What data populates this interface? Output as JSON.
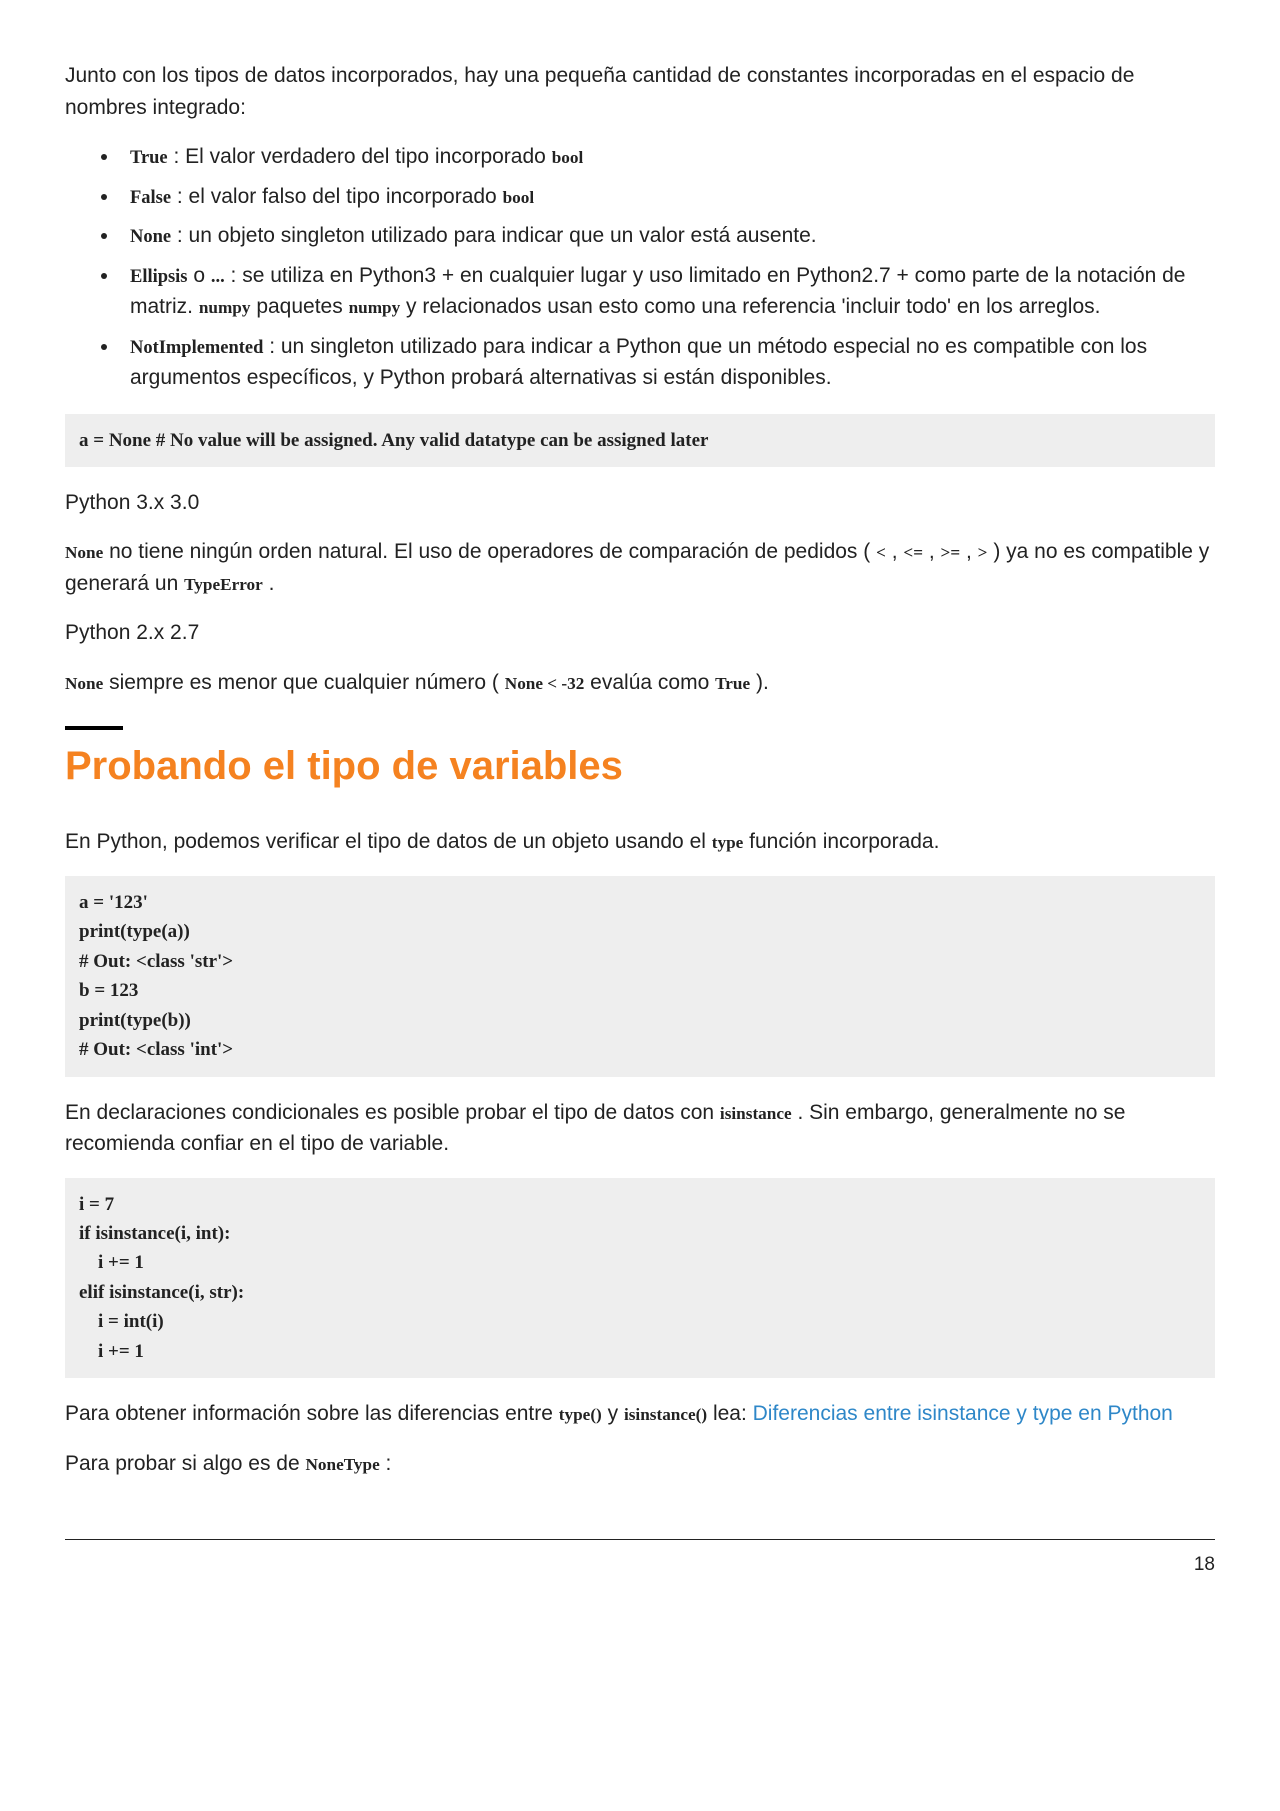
{
  "intro": "Junto con los tipos de datos incorporados, hay una pequeña cantidad de constantes incorporadas en el espacio de nombres integrado:",
  "bullets": {
    "b1_code": "True",
    "b1_text": " : El valor verdadero del tipo incorporado",
    "b1_code2": "bool",
    "b2_code": "False",
    "b2_text": " : el valor falso del tipo incorporado",
    "b2_code2": "bool",
    "b3_code": "None",
    "b3_text": " : un objeto singleton utilizado para indicar que un valor está ausente.",
    "b4_code": "Ellipsis",
    "b4_text_a": " o ",
    "b4_code2": "...",
    "b4_text_b": " : se utiliza en Python3 + en cualquier lugar y uso limitado en Python2.7 + como parte de la notación de matriz. ",
    "b4_code3": "numpy",
    "b4_text_c": " paquetes ",
    "b4_code4": "numpy",
    "b4_text_d": " y relacionados usan esto como una referencia 'incluir todo' en los arreglos.",
    "b5_code": "NotImplemented",
    "b5_text": " : un singleton utilizado para indicar a Python que un método especial no es compatible con los argumentos específicos, y Python probará alternativas si están disponibles."
  },
  "code1": "a = None # No value will be assigned. Any valid datatype can be assigned later",
  "py3_heading": "Python 3.x 3.0",
  "py3_para": {
    "code1": "None",
    "text1": " no tiene ningún orden natural. El uso de operadores de comparación de pedidos ( ",
    "op1": "<",
    "sep": " , ",
    "op2": "<=",
    "op3": ">=",
    "op4": ">",
    "text2": " ) ya no es compatible y generará un ",
    "code2": "TypeError",
    "period": " ."
  },
  "py27_heading": "Python 2.x 2.7",
  "py27_para": {
    "code1": "None",
    "text1": " siempre es menor que cualquier número ( ",
    "code2": "None < -32",
    "text2": " evalúa como ",
    "code3": "True",
    "text3": " )."
  },
  "section_title": "Probando el tipo de variables",
  "section_intro_a": "En Python, podemos verificar el tipo de datos de un objeto usando el ",
  "section_intro_code": "type",
  "section_intro_b": " función incorporada.",
  "code2": "a = '123'\nprint(type(a))\n# Out: <class 'str'>\nb = 123\nprint(type(b))\n# Out: <class 'int'>",
  "conditional_a": "En declaraciones condicionales es posible probar el tipo de datos con ",
  "conditional_code": "isinstance",
  "conditional_b": " . Sin embargo, generalmente no se recomienda confiar en el tipo de variable.",
  "code3": "i = 7\nif isinstance(i, int):\n    i += 1\nelif isinstance(i, str):\n    i = int(i)\n    i += 1",
  "diff_a": "Para obtener información sobre las diferencias entre ",
  "diff_code1": "type()",
  "diff_mid": " y ",
  "diff_code2": "isinstance()",
  "diff_b": " lea: ",
  "diff_link": "Diferencias entre isinstance y type en Python",
  "nonetype_a": "Para probar si algo es de ",
  "nonetype_code": "NoneType",
  "nonetype_b": " :",
  "page_number": "18"
}
